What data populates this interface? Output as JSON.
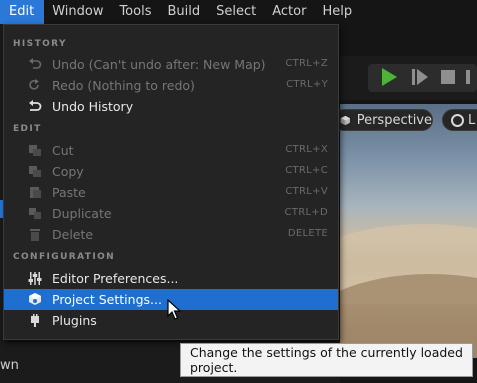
{
  "menubar": {
    "items": [
      {
        "label": "Edit",
        "active": true
      },
      {
        "label": "Window"
      },
      {
        "label": "Tools"
      },
      {
        "label": "Build"
      },
      {
        "label": "Select"
      },
      {
        "label": "Actor"
      },
      {
        "label": "Help"
      }
    ]
  },
  "viewport": {
    "perspective_label": "Perspective",
    "lit_label": "L"
  },
  "left_panel": {
    "partial_text": "wn"
  },
  "menu": {
    "sections": {
      "history": "HISTORY",
      "edit": "EDIT",
      "configuration": "CONFIGURATION"
    },
    "history": [
      {
        "label": "Undo (Can't undo after: New Map)",
        "shortcut": "CTRL+Z",
        "icon": "undo-icon",
        "enabled": false
      },
      {
        "label": "Redo (Nothing to redo)",
        "shortcut": "CTRL+Y",
        "icon": "redo-icon",
        "enabled": false
      },
      {
        "label": "Undo History",
        "shortcut": "",
        "icon": "undo-history-icon",
        "enabled": true
      }
    ],
    "edit": [
      {
        "label": "Cut",
        "shortcut": "CTRL+X",
        "icon": "cut-icon",
        "enabled": false
      },
      {
        "label": "Copy",
        "shortcut": "CTRL+C",
        "icon": "copy-icon",
        "enabled": false
      },
      {
        "label": "Paste",
        "shortcut": "CTRL+V",
        "icon": "paste-icon",
        "enabled": false
      },
      {
        "label": "Duplicate",
        "shortcut": "CTRL+D",
        "icon": "duplicate-icon",
        "enabled": false
      },
      {
        "label": "Delete",
        "shortcut": "DELETE",
        "icon": "delete-icon",
        "enabled": false
      }
    ],
    "configuration": [
      {
        "label": "Editor Preferences...",
        "icon": "sliders-icon",
        "enabled": true
      },
      {
        "label": "Project Settings...",
        "icon": "project-settings-icon",
        "enabled": true,
        "highlighted": true
      },
      {
        "label": "Plugins",
        "icon": "plugin-icon",
        "enabled": true
      }
    ]
  },
  "tooltip": {
    "text": "Change the settings of the currently loaded project."
  },
  "colors": {
    "accent": "#1f6fd0",
    "play": "#4fb33a",
    "menu_bg": "#242424"
  }
}
